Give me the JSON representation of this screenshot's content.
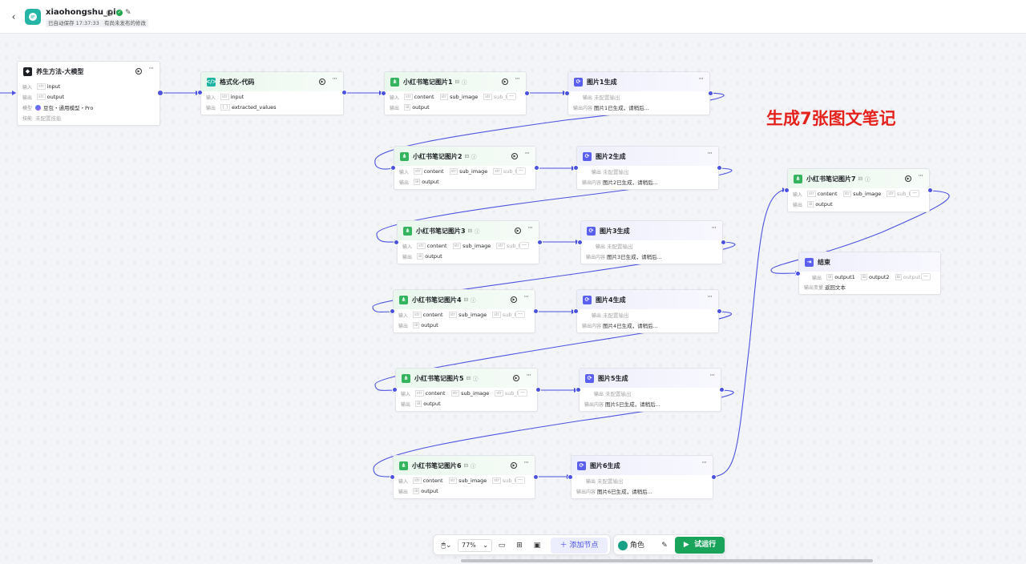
{
  "app": {
    "title": "xiaohongshu_pic",
    "saved_status": "已自动保存 17:37:33",
    "unpublished_status": "有尚未发布的修改"
  },
  "annotation": "生成7张图文笔记",
  "labels": {
    "input": "输入",
    "output": "输出",
    "model": "模型",
    "skills": "技能",
    "output_content": "输出内容",
    "output_var": "输出变量"
  },
  "types": {
    "str": "str",
    "obj": "{ }"
  },
  "nodes": {
    "llm": {
      "title": "养生方法-大模型",
      "input": "input",
      "output": "output",
      "model": "豆包・通用模型・Pro",
      "skills": "未配置技能"
    },
    "code": {
      "title": "格式化-代码",
      "input": "input",
      "output": "extracted_values"
    },
    "plugins": [
      {
        "title": "小红书笔记图片1"
      },
      {
        "title": "小红书笔记图片2"
      },
      {
        "title": "小红书笔记图片3"
      },
      {
        "title": "小红书笔记图片4"
      },
      {
        "title": "小红书笔记图片5"
      },
      {
        "title": "小红书笔记图片6"
      },
      {
        "title": "小红书笔记图片7"
      }
    ],
    "plugin_params": {
      "content": "content",
      "sub_image": "sub_image",
      "sub_title": "sub_title",
      "output": "output"
    },
    "messages": [
      {
        "title": "图片1生成",
        "content": "图片1已生成，请稍后..."
      },
      {
        "title": "图片2生成",
        "content": "图片2已生成，请稍后..."
      },
      {
        "title": "图片3生成",
        "content": "图片3已生成，请稍后..."
      },
      {
        "title": "图片4生成",
        "content": "图片4已生成，请稍后..."
      },
      {
        "title": "图片5生成",
        "content": "图片5已生成，请稍后..."
      },
      {
        "title": "图片6生成",
        "content": "图片6已生成，请稍后..."
      }
    ],
    "message_output": "未配置输出",
    "end": {
      "title": "结束",
      "outputs": [
        "output1",
        "output2",
        "output3"
      ],
      "output_var": "返回文本"
    }
  },
  "toolbar": {
    "zoom": "77%",
    "add_node": "添加节点",
    "role": "角色",
    "run": "试运行"
  },
  "colors": {
    "accent": "#4c52e0",
    "run": "#1aa35b",
    "annotation": "#e5211c"
  }
}
